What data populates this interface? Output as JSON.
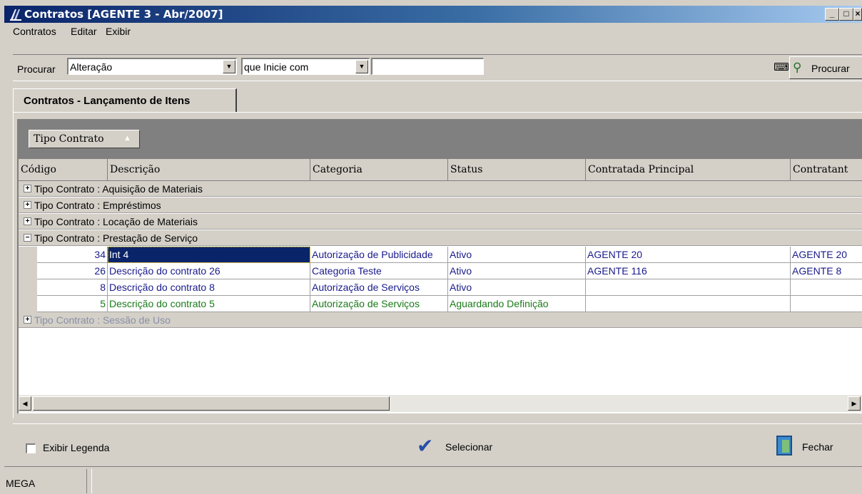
{
  "window": {
    "title": "Contratos [AGENTE 3 - Abr/2007]",
    "minimize": "_",
    "maximize": "□",
    "close": "×"
  },
  "menu": [
    "Contratos",
    "Editar",
    "Exibir"
  ],
  "search": {
    "label": "Procurar",
    "field_value": "Alteração",
    "operator_value": "que Inicie com",
    "text_value": "",
    "button_label": "Procurar"
  },
  "tab": {
    "label": "Contratos - Lançamento de Itens"
  },
  "grid": {
    "group_by": "Tipo Contrato",
    "group_sort_indicator": "▲",
    "columns": [
      "Código",
      "Descrição",
      "Categoria",
      "Status",
      "Contratada Principal",
      "Contratant"
    ],
    "groups": [
      {
        "label": "Tipo Contrato : Aquisição de Materiais",
        "expander": "+"
      },
      {
        "label": "Tipo Contrato : Empréstimos",
        "expander": "+"
      },
      {
        "label": "Tipo Contrato : Locação de Materiais",
        "expander": "+"
      },
      {
        "label": "Tipo Contrato : Prestação de Serviço",
        "expander": "−"
      },
      {
        "label": "Tipo Contrato : Sessão de Uso",
        "expander": "+"
      }
    ],
    "rows": [
      {
        "codigo": "34",
        "descricao": "Int 4",
        "categoria": "Autorização de Publicidade",
        "status": "Ativo",
        "contratada": "AGENTE 20",
        "contratante": "AGENTE 20"
      },
      {
        "codigo": "26",
        "descricao": "Descrição do contrato 26",
        "categoria": "Categoria Teste",
        "status": "Ativo",
        "contratada": "AGENTE 116",
        "contratante": "AGENTE 8"
      },
      {
        "codigo": "8",
        "descricao": "Descrição do contrato 8",
        "categoria": "Autorização de Serviços",
        "status": "Ativo",
        "contratada": "",
        "contratante": ""
      },
      {
        "codigo": "5",
        "descricao": "Descrição do contrato 5",
        "categoria": "Autorização de Serviços",
        "status": "Aguardando Definição",
        "contratada": "",
        "contratante": ""
      }
    ]
  },
  "footer": {
    "legend_label": "Exibir Legenda",
    "select_label": "Selecionar",
    "close_label": "Fechar"
  },
  "status": {
    "text": "MEGA"
  },
  "colors": {
    "active_text": "#1a1a8c",
    "pending_text": "#1a7a1a",
    "selection": "#0a246a"
  },
  "icons": {
    "filter": "filter-icon",
    "search": "binoculars-icon",
    "select": "checkmark-icon",
    "close": "door-exit-icon"
  }
}
